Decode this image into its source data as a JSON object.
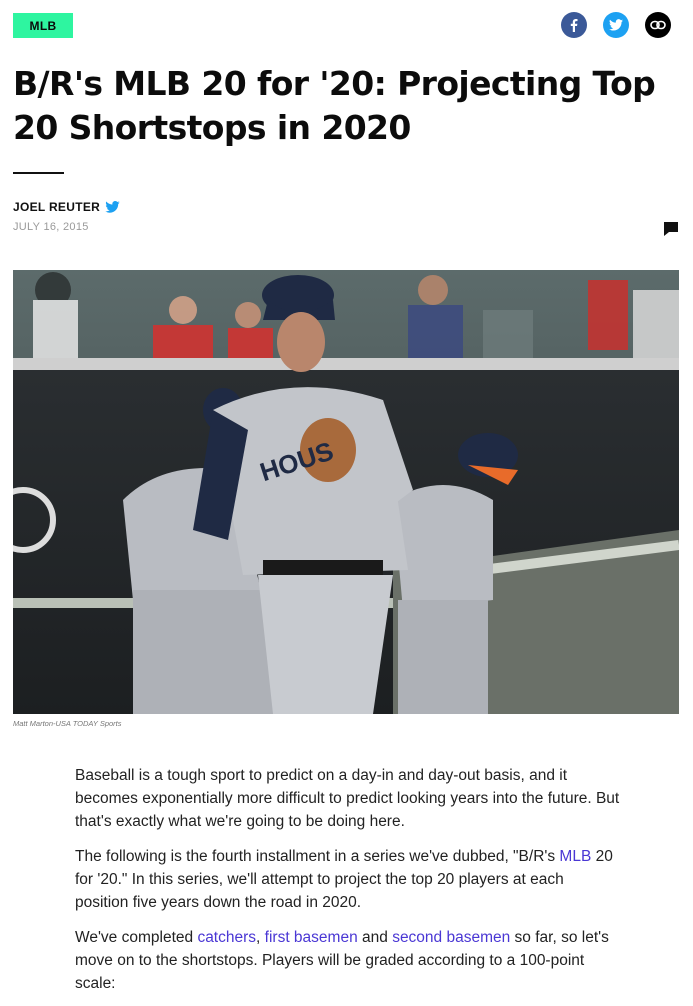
{
  "header": {
    "category": "MLB",
    "share": [
      {
        "icon": "facebook-icon",
        "color": "#3b5998"
      },
      {
        "icon": "twitter-icon",
        "color": "#1da1f2"
      },
      {
        "icon": "link-icon",
        "color": "#000000"
      }
    ]
  },
  "article": {
    "title_line1": "B/R's MLB 20 for '20: Projecting Top",
    "title_line2": "20 Shortstops in 2020",
    "author": "JOEL REUTER",
    "date": "JULY 16, 2015",
    "photo_credit": "Matt Marton-USA TODAY Sports"
  },
  "body": {
    "p1": "Baseball is a tough sport to predict on a day-in and day-out basis, and it becomes exponentially more difficult to predict looking years into the future. But that's exactly what we're going to be doing here.",
    "p2_a": "The following is the fourth installment in a series we've dubbed, \"B/R's ",
    "p2_link": "MLB",
    "p2_b": " 20 for '20.\" In this series, we'll attempt to project the top 20 players at each position five years down the road in 2020.",
    "p3_a": "We've completed ",
    "p3_link1": "catchers",
    "p3_sep1": ", ",
    "p3_link2": "first basemen",
    "p3_sep2": " and ",
    "p3_link3": "second basemen",
    "p3_b": " so far, so let's move on to the shortstops. Players will be graded according to a 100-point scale:"
  },
  "colors": {
    "tag_bg": "#2ef5a0",
    "link": "#4a37d4",
    "date": "#9a9a9a"
  }
}
